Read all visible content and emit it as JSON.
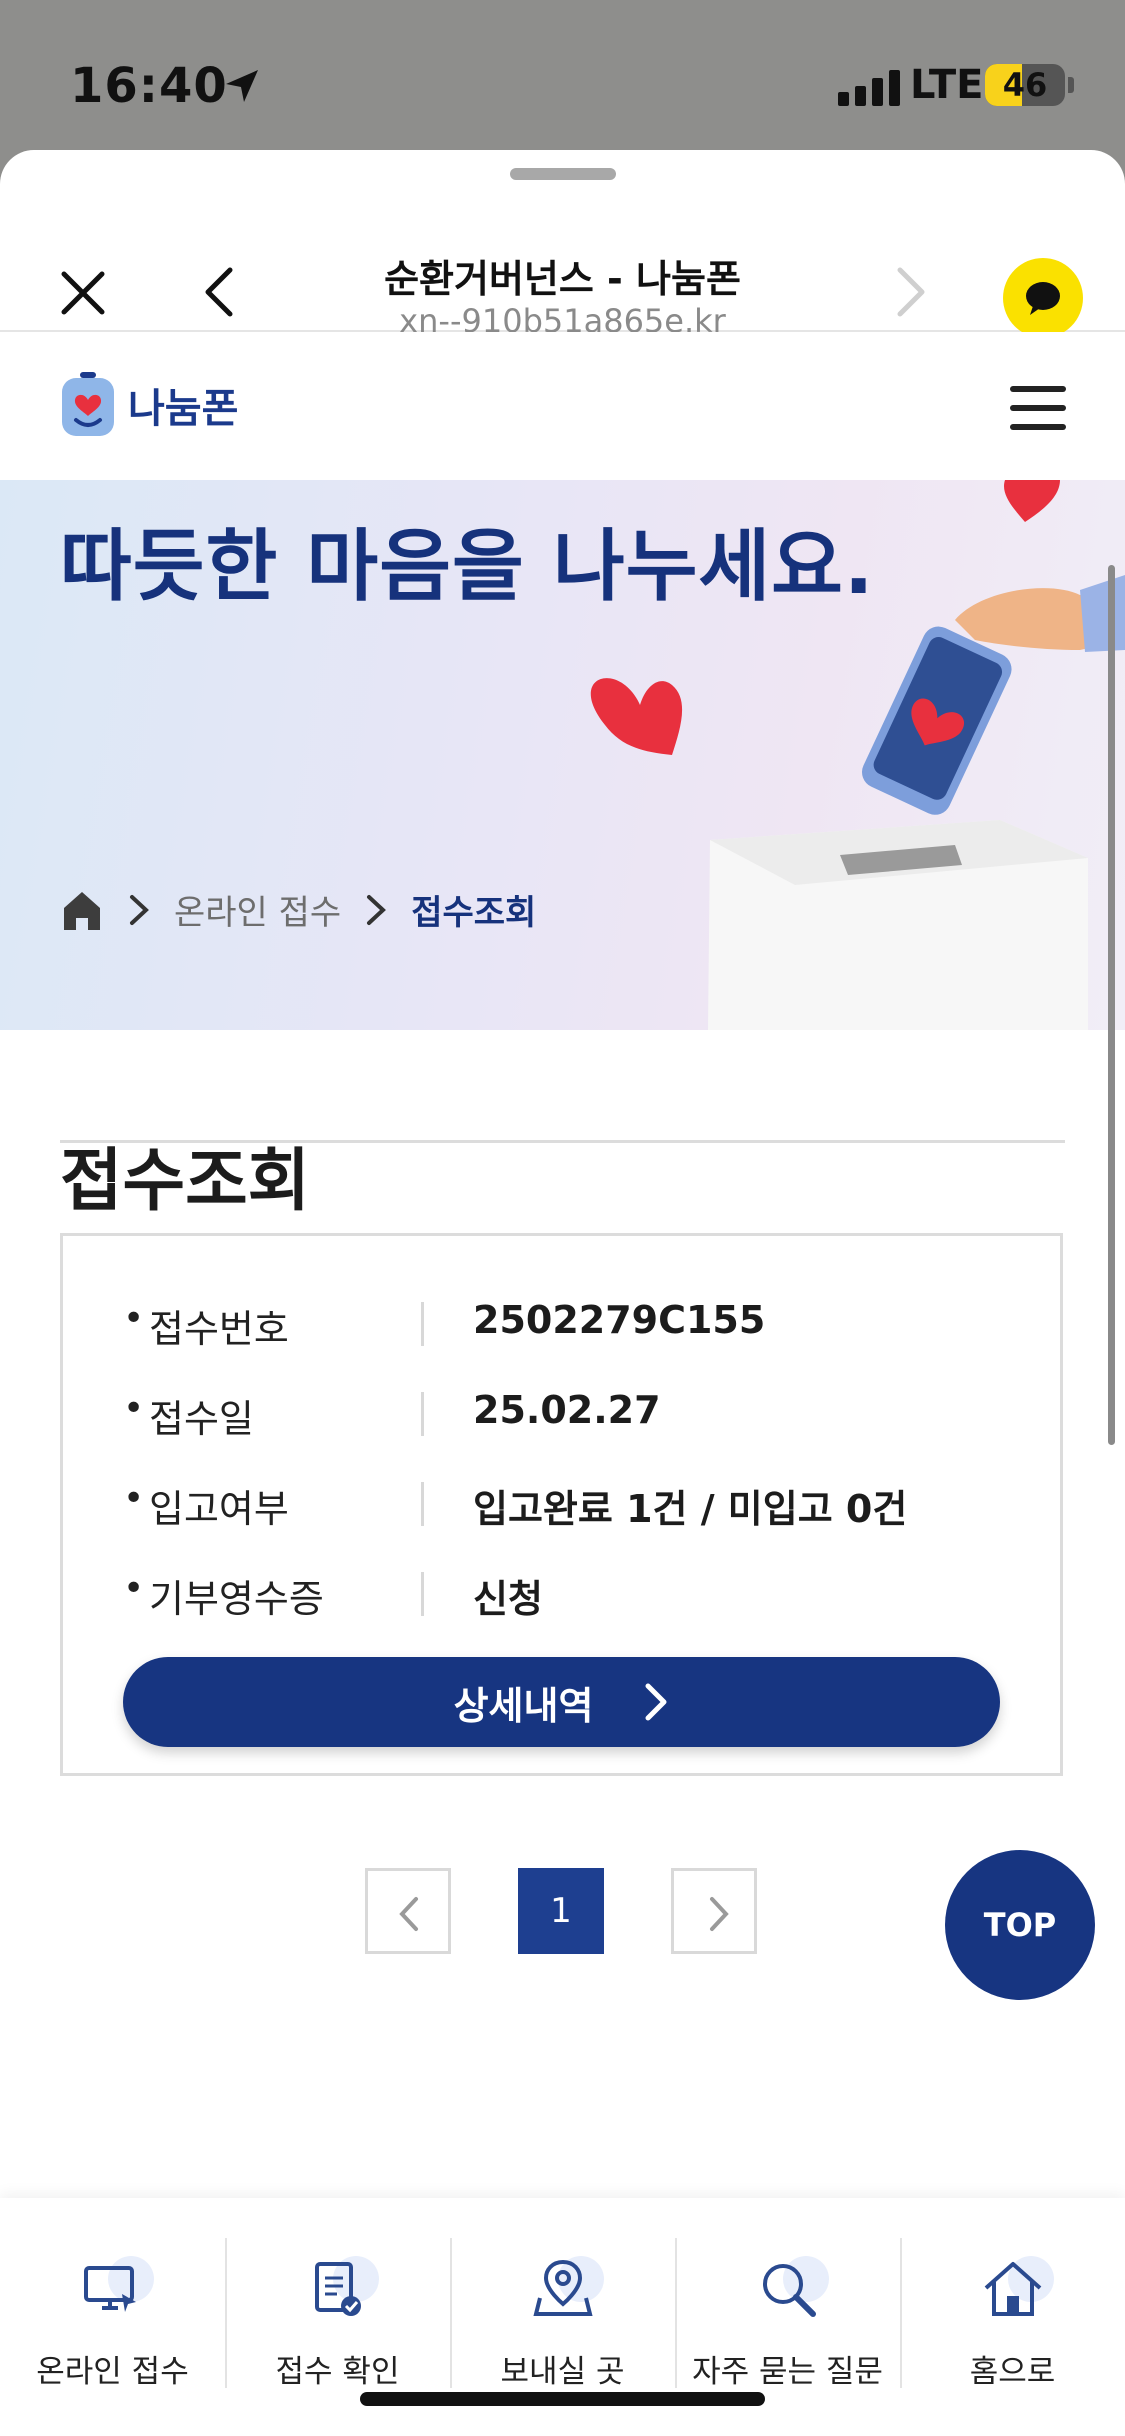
{
  "status_bar": {
    "time": "16:40",
    "network": "LTE",
    "battery": "46",
    "battery_level": 0.46
  },
  "browser": {
    "title": "순환거버넌스 - 나눔폰",
    "url": "xn--910b51a865e.kr"
  },
  "site": {
    "logo_text": "나눔폰"
  },
  "hero": {
    "title": "따듯한 마음을 나누세요.",
    "breadcrumb": [
      "온라인 접수",
      "접수조회"
    ]
  },
  "content": {
    "title": "접수조회",
    "rows": [
      {
        "label": "접수번호",
        "value": "2502279C155"
      },
      {
        "label": "접수일",
        "value": "25.02.27"
      },
      {
        "label": "입고여부",
        "value": "입고완료 1건 / 미입고 0건"
      },
      {
        "label": "기부영수증",
        "value": "신청"
      }
    ],
    "bullet": "•",
    "detail_button": "상세내역"
  },
  "pagination": {
    "current": "1"
  },
  "top_button": "TOP",
  "bottom_nav": [
    {
      "label": "온라인 접수",
      "icon": "monitor-icon"
    },
    {
      "label": "접수 확인",
      "icon": "clipboard-check-icon"
    },
    {
      "label": "보내실 곳",
      "icon": "map-pin-icon"
    },
    {
      "label": "자주 묻는 질문",
      "icon": "search-icon"
    },
    {
      "label": "홈으로",
      "icon": "home-icon"
    }
  ],
  "colors": {
    "brand_navy": "#173581",
    "kakao_yellow": "#fae100",
    "heart_red": "#e8303e"
  }
}
